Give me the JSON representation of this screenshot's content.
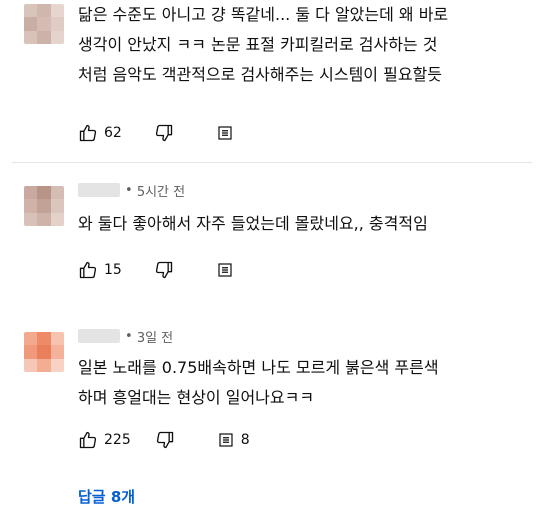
{
  "comments": [
    {
      "lines": [
        "닮은 수준도 아니고 걍 똑같네... 둘 다 알았는데 왜 바로",
        "생각이 안났지 ㅋㅋ 논문 표절 카피킬러로 검사하는 것",
        "처럼 음악도 객관적으로 검사해주는 시스템이 필요할듯"
      ],
      "likes": "62",
      "avatar_colors": [
        "#d9c4bc",
        "#cfb7ae",
        "#e6d6cf",
        "#c9aea4",
        "#d4bcb3",
        "#e0ccc4",
        "#d8c2b9",
        "#ccb2a8",
        "#e5d4cd"
      ]
    },
    {
      "time": "5시간 전",
      "lines": [
        "와 둘다 좋아해서 자주 들었는데 몰랐네요,, 충격적임"
      ],
      "likes": "15",
      "avatar_colors": [
        "#c9a9a0",
        "#b89488",
        "#d6bdb4",
        "#d0b2a8",
        "#c2a196",
        "#dbc6be",
        "#d8c1b8",
        "#ceb3a9",
        "#e3d1ca"
      ]
    },
    {
      "time": "3일 전",
      "lines": [
        "일본 노래를 0.75배속하면 나도 모르게 붉은색 푸른색",
        "하며 흥얼대는 현상이 일어나요ㅋㅋ"
      ],
      "likes": "225",
      "replies_count": "8",
      "avatar_colors": [
        "#f3a98e",
        "#ee8a67",
        "#f7c2ae",
        "#f09a7b",
        "#ea7f5c",
        "#f4b29b",
        "#f6c7b6",
        "#f2ad93",
        "#f8d3c5"
      ]
    }
  ],
  "replies_link": "답글 8개",
  "icons": {
    "like": "thumbs-up-icon",
    "dislike": "thumbs-down-icon",
    "reply": "reply-icon"
  }
}
